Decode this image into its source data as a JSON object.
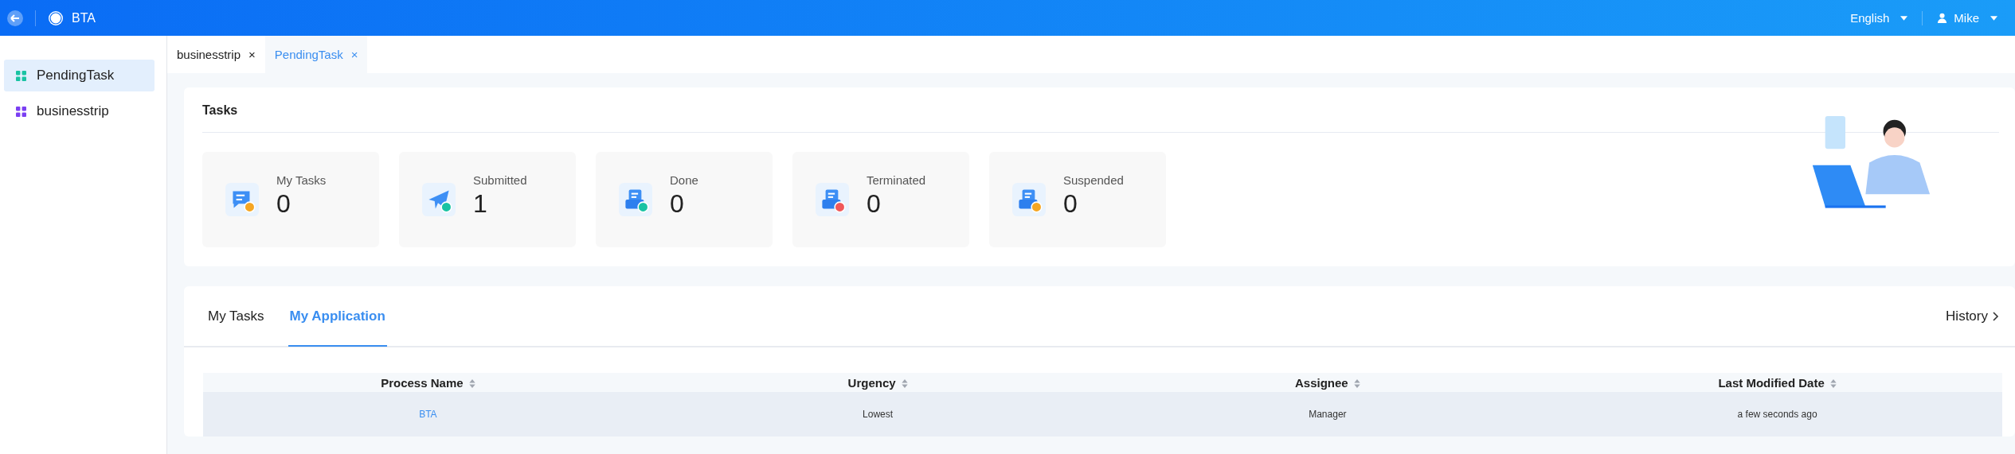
{
  "header": {
    "app_name": "BTA",
    "language": "English",
    "user": "Mike"
  },
  "sidebar": {
    "items": [
      {
        "label": "PendingTask",
        "selected": true
      },
      {
        "label": "businesstrip",
        "selected": false
      }
    ]
  },
  "page_tabs": [
    {
      "label": "businesstrip",
      "close": "×",
      "selected": false
    },
    {
      "label": "PendingTask",
      "close": "×",
      "selected": true
    }
  ],
  "tasks": {
    "title": "Tasks",
    "stats": [
      {
        "label": "My Tasks",
        "count": "0"
      },
      {
        "label": "Submitted",
        "count": "1"
      },
      {
        "label": "Done",
        "count": "0"
      },
      {
        "label": "Terminated",
        "count": "0"
      },
      {
        "label": "Suspended",
        "count": "0"
      }
    ]
  },
  "list": {
    "tabs": [
      {
        "label": "My Tasks",
        "selected": false
      },
      {
        "label": "My Application",
        "selected": true
      }
    ],
    "history": "History",
    "table": {
      "columns": [
        "Process Name",
        "Urgency",
        "Assignee",
        "Last Modified Date"
      ],
      "rows": [
        {
          "process": "BTA",
          "urgency": "Lowest",
          "assignee": "Manager",
          "modified": "a few seconds ago"
        }
      ]
    }
  }
}
